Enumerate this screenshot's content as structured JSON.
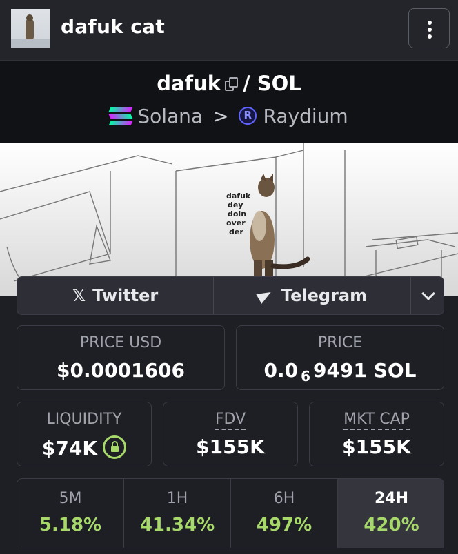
{
  "header": {
    "token_name": "dafuk cat"
  },
  "pair": {
    "base": "dafuk",
    "separator": "/",
    "quote": "SOL"
  },
  "chain": {
    "network": "Solana",
    "arrow": ">",
    "dex": "Raydium"
  },
  "banner": {
    "caption_lines": [
      "dafuk",
      "dey",
      "doin",
      "over",
      "der"
    ]
  },
  "socials": {
    "twitter_label": "Twitter",
    "telegram_label": "Telegram"
  },
  "stats": {
    "price_usd": {
      "label": "PRICE USD",
      "value": "$0.0001606"
    },
    "price": {
      "label": "PRICE",
      "prefix": "0.0",
      "zeros": "6",
      "digits": "9491",
      "unit": "SOL"
    },
    "liquidity": {
      "label": "LIQUIDITY",
      "value": "$74K"
    },
    "fdv": {
      "label": "FDV",
      "value": "$155K"
    },
    "mkt_cap": {
      "label": "MKT CAP",
      "value": "$155K"
    }
  },
  "changes": [
    {
      "label": "5M",
      "value": "5.18%"
    },
    {
      "label": "1H",
      "value": "41.34%"
    },
    {
      "label": "6H",
      "value": "497%"
    },
    {
      "label": "24H",
      "value": "420%"
    }
  ],
  "colors": {
    "accent_green": "#a6d86a",
    "background": "#1e1f24"
  }
}
